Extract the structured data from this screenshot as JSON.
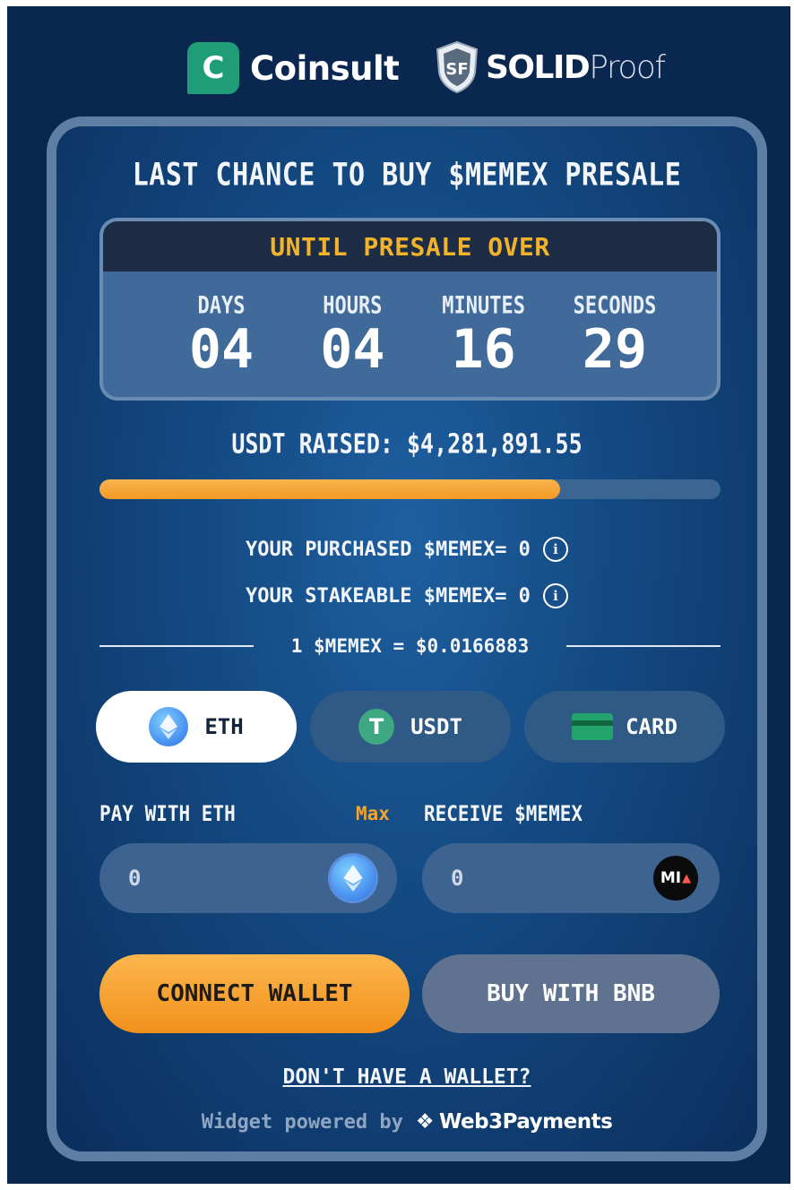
{
  "logos": {
    "coinsult_mark": "C",
    "coinsult": "Coinsult",
    "solid_mark": "SF",
    "solid_bold": "SOLID",
    "solid_light": "Proof"
  },
  "title": "LAST CHANCE TO BUY $MEMEX PRESALE",
  "timer": {
    "header": "UNTIL PRESALE OVER",
    "days_label": "DAYS",
    "days": "04",
    "hours_label": "HOURS",
    "hours": "04",
    "minutes_label": "MINUTES",
    "minutes": "16",
    "seconds_label": "SECONDS",
    "seconds": "29"
  },
  "raised": "USDT RAISED: $4,281,891.55",
  "progress_fraction": 0.742,
  "purchased": "YOUR PURCHASED $MEMEX= 0",
  "stakeable": "YOUR STAKEABLE $MEMEX= 0",
  "info_icon": "i",
  "rate": "1 $MEMEX = $0.0166883",
  "tabs": {
    "eth": "ETH",
    "usdt": "USDT",
    "card": "CARD",
    "usdt_icon": "T"
  },
  "pay_label": "PAY WITH ETH",
  "max_label": "Max",
  "receive_label": "RECEIVE $MEMEX",
  "pay_placeholder": "0",
  "receive_placeholder": "0",
  "memex_icon": "MI",
  "connect_button": "CONNECT WALLET",
  "bnb_button": "BUY WITH BNB",
  "no_wallet": "DON'T HAVE A WALLET?",
  "powered_by": "Widget powered by",
  "powered_brand": "Web3Payments",
  "colors": {
    "accent": "#f3a52d",
    "background": "#0a2750",
    "panel": "#134880"
  }
}
